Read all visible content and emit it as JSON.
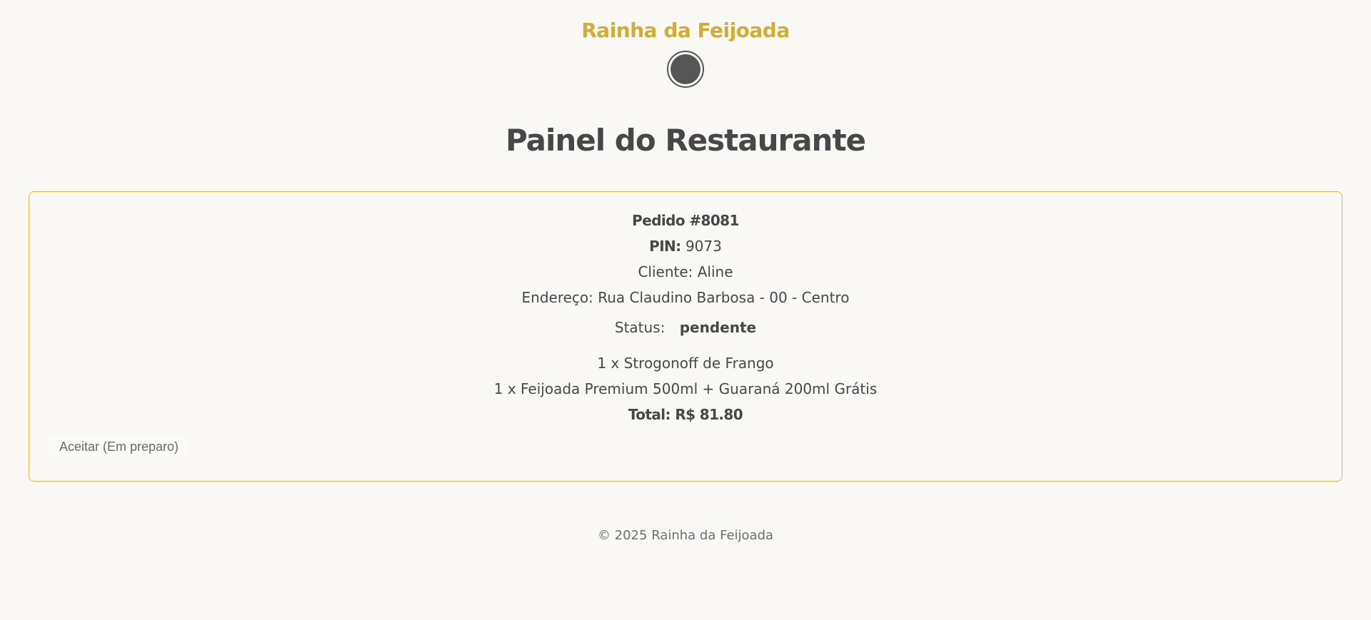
{
  "header": {
    "brand": "Rainha da Feijoada",
    "logo_icon": "dish-logo-icon"
  },
  "page_title": "Painel do Restaurante",
  "order": {
    "title": "Pedido #8081",
    "pin_label": "PIN:",
    "pin_value": "9073",
    "customer": "Cliente: Aline",
    "address": "Endereço: Rua Claudino Barbosa - 00 - Centro",
    "status_label": "Status:",
    "status_value": "pendente",
    "items": [
      "1 x Strogonoff de Frango",
      "1 x Feijoada Premium 500ml + Guaraná 200ml Grátis"
    ],
    "total": "Total: R$ 81.80",
    "accept_button": "Aceitar (Em preparo)"
  },
  "footer": {
    "copyright": "© 2025 Rainha da Feijoada"
  },
  "colors": {
    "brand": "#d4ac2f",
    "background": "#f9f8f4",
    "text": "#474747",
    "card_border": "#e0b63e"
  }
}
